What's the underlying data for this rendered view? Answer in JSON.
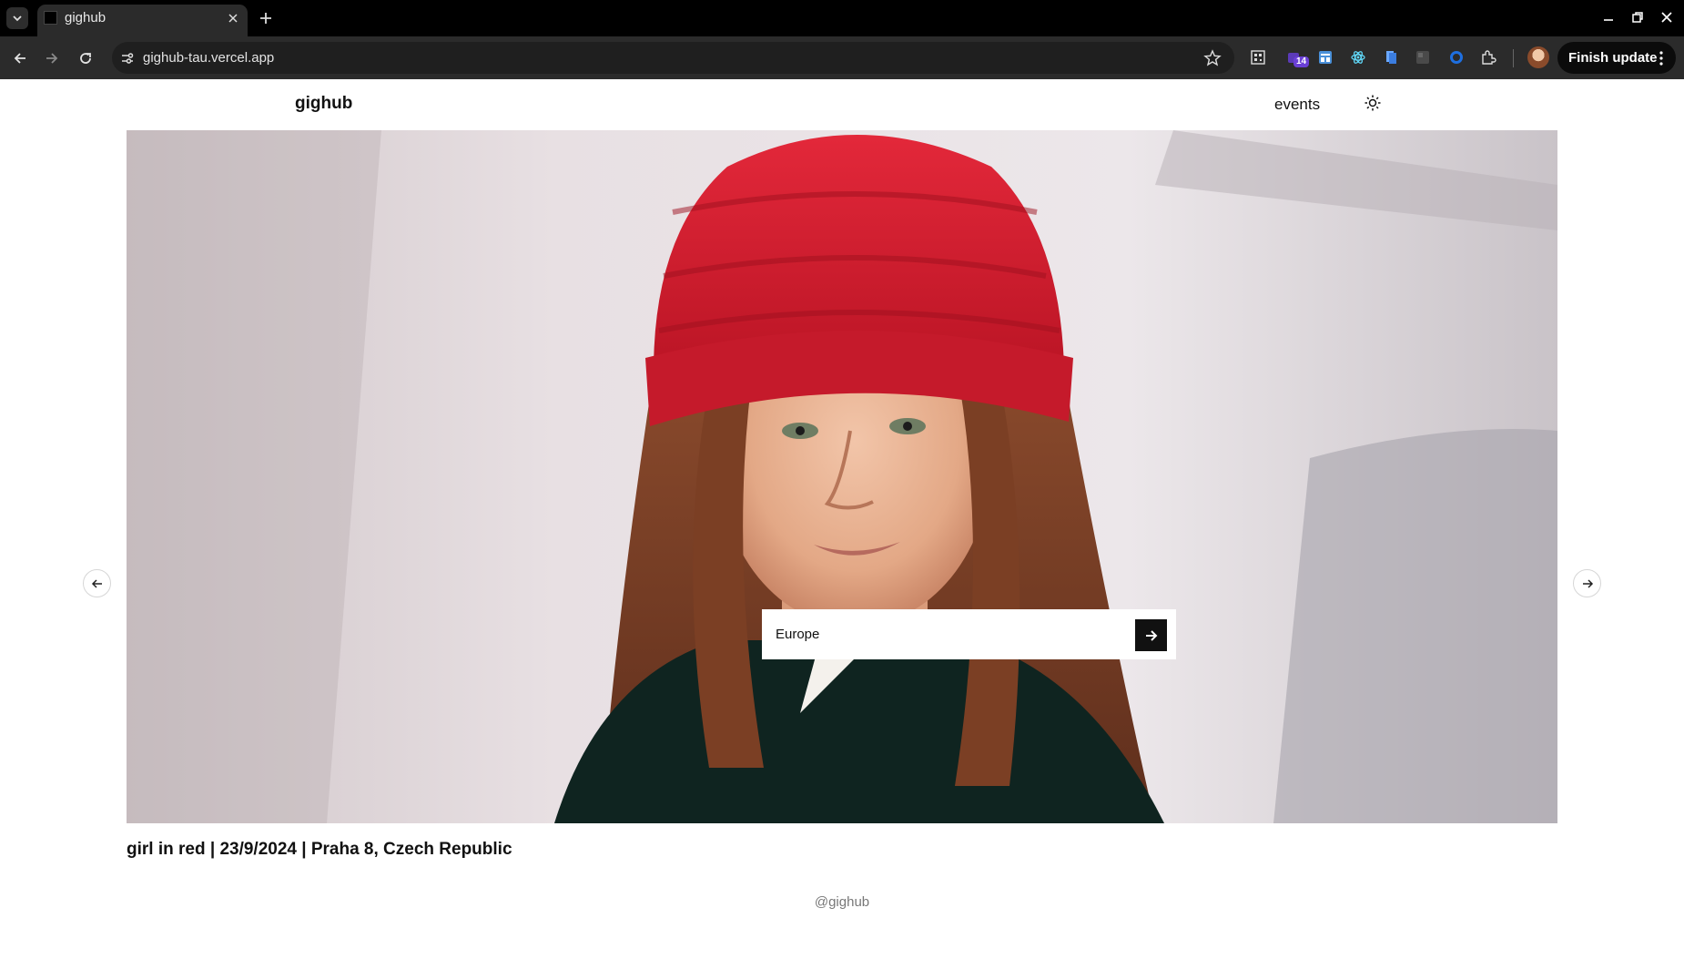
{
  "browser": {
    "tab_title": "gighub",
    "url": "gighub-tau.vercel.app",
    "extension_badge": "14",
    "finish_update_label": "Finish update"
  },
  "header": {
    "brand": "gighub",
    "nav_events": "events"
  },
  "hero": {
    "search_value": "Europe",
    "caption": "girl in red | 23/9/2024 | Praha 8, Czech Republic"
  },
  "footer": {
    "text": "@gighub"
  },
  "colors": {
    "accent": "#111111",
    "hat_red": "#d91a2a"
  },
  "icons": [
    "tab-search-icon",
    "close-icon",
    "plus-icon",
    "back-icon",
    "forward-icon",
    "reload-icon",
    "site-info-icon",
    "star-icon",
    "extension-icon",
    "sun-icon",
    "arrow-right-icon",
    "arrow-left-icon"
  ]
}
